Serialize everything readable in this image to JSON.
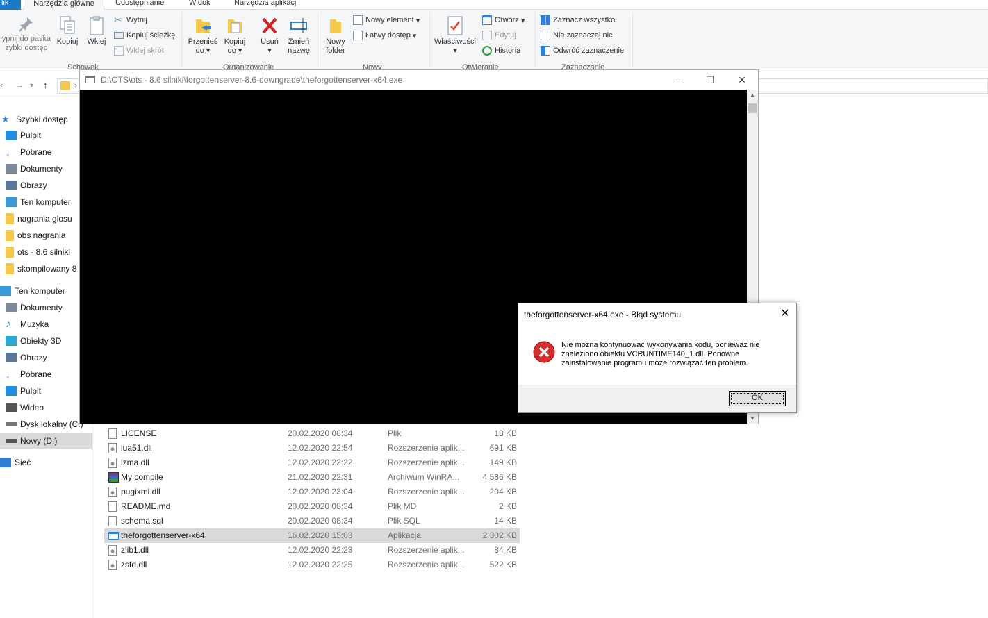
{
  "ribbon": {
    "tabs": [
      "lik",
      "Narzędzia główne",
      "Udostępnianie",
      "Widok",
      "Narzędzia aplikacji"
    ],
    "pin_label_1": "ypnij do paska",
    "pin_label_2": "zybki dostęp",
    "copy": "Kopiuj",
    "paste": "Wklej",
    "cut": "Wytnij",
    "copy_path": "Kopiuj ścieżkę",
    "paste_shortcut": "Wklej skrót",
    "group_clipboard": "Schowek",
    "move_to_1": "Przenieś",
    "move_to_2": "do",
    "copy_to_1": "Kopiuj",
    "copy_to_2": "do",
    "delete": "Usuń",
    "rename_1": "Zmień",
    "rename_2": "nazwę",
    "group_organize": "Organizowanie",
    "new_folder_1": "Nowy",
    "new_folder_2": "folder",
    "new_item": "Nowy element",
    "easy_access": "Łatwy dostęp",
    "group_new": "Nowy",
    "properties": "Właściwości",
    "open": "Otwórz",
    "edit": "Edytuj",
    "history": "Historia",
    "group_open": "Otwieranie",
    "select_all": "Zaznacz wszystko",
    "select_none": "Nie zaznaczaj nic",
    "invert_selection": "Odwróć zaznaczenie",
    "group_select": "Zaznaczanie"
  },
  "nav": {
    "items": [
      {
        "label": "Szybki dostęp",
        "icon": "star-icon",
        "color": "#2f7fd8"
      },
      {
        "label": "Pulpit",
        "icon": "desktop-icon",
        "color": "#1e90e0"
      },
      {
        "label": "Pobrane",
        "icon": "download-icon",
        "color": "#2f7fd8"
      },
      {
        "label": "Dokumenty",
        "icon": "documents-icon",
        "color": "#7a8a9a"
      },
      {
        "label": "Obrazy",
        "icon": "pictures-icon",
        "color": "#5a7896"
      },
      {
        "label": "Ten komputer",
        "icon": "computer-icon",
        "color": "#3a9ad9"
      },
      {
        "label": "nagrania glosu",
        "icon": "folder-icon",
        "color": "#f3c84b"
      },
      {
        "label": "obs nagrania",
        "icon": "folder-icon",
        "color": "#f3c84b"
      },
      {
        "label": "ots - 8.6 silniki",
        "icon": "folder-icon",
        "color": "#f3c84b"
      },
      {
        "label": "skompilowany 8",
        "icon": "folder-icon",
        "color": "#f3c84b"
      },
      {
        "label": "Ten komputer",
        "icon": "computer-icon",
        "color": "#3a9ad9"
      },
      {
        "label": "Dokumenty",
        "icon": "documents-icon",
        "color": "#7a8a9a"
      },
      {
        "label": "Muzyka",
        "icon": "music-icon",
        "color": "#2f7fd8"
      },
      {
        "label": "Obiekty 3D",
        "icon": "cube-icon",
        "color": "#2aa8d8"
      },
      {
        "label": "Obrazy",
        "icon": "pictures-icon",
        "color": "#5a7896"
      },
      {
        "label": "Pobrane",
        "icon": "download-icon",
        "color": "#2f7fd8"
      },
      {
        "label": "Pulpit",
        "icon": "desktop-icon",
        "color": "#1e90e0"
      },
      {
        "label": "Wideo",
        "icon": "video-icon",
        "color": "#555555"
      },
      {
        "label": "Dysk lokalny (C:)",
        "icon": "drive-icon",
        "color": "#777777"
      },
      {
        "label": "Nowy (D:)",
        "icon": "drive-icon",
        "color": "#555555"
      },
      {
        "label": "Sieć",
        "icon": "network-icon",
        "color": "#2f7fd8"
      }
    ]
  },
  "files": [
    {
      "name": "LICENSE",
      "date": "20.02.2020 08:34",
      "type": "Plik",
      "size": "18 KB",
      "icon": "file-icon"
    },
    {
      "name": "lua51.dll",
      "date": "12.02.2020 22:54",
      "type": "Rozszerzenie aplik...",
      "size": "691 KB",
      "icon": "dll-icon"
    },
    {
      "name": "lzma.dll",
      "date": "12.02.2020 22:22",
      "type": "Rozszerzenie aplik...",
      "size": "149 KB",
      "icon": "dll-icon"
    },
    {
      "name": "My compile",
      "date": "21.02.2020 22:31",
      "type": "Archiwum WinRA...",
      "size": "4 586 KB",
      "icon": "winrar-icon"
    },
    {
      "name": "pugixml.dll",
      "date": "12.02.2020 23:04",
      "type": "Rozszerzenie aplik...",
      "size": "204 KB",
      "icon": "dll-icon"
    },
    {
      "name": "README.md",
      "date": "20.02.2020 08:34",
      "type": "Plik MD",
      "size": "2 KB",
      "icon": "file-icon"
    },
    {
      "name": "schema.sql",
      "date": "20.02.2020 08:34",
      "type": "Plik SQL",
      "size": "14 KB",
      "icon": "file-icon"
    },
    {
      "name": "theforgottenserver-x64",
      "date": "16.02.2020 15:03",
      "type": "Aplikacja",
      "size": "2 302 KB",
      "icon": "exe-icon"
    },
    {
      "name": "zlib1.dll",
      "date": "12.02.2020 22:23",
      "type": "Rozszerzenie aplik...",
      "size": "84 KB",
      "icon": "dll-icon"
    },
    {
      "name": "zstd.dll",
      "date": "12.02.2020 22:25",
      "type": "Rozszerzenie aplik...",
      "size": "522 KB",
      "icon": "dll-icon"
    }
  ],
  "console": {
    "title": "D:\\OTS\\ots - 8.6 silniki\\forgottenserver-8.6-downgrade\\theforgottenserver-x64.exe",
    "minimize": "—",
    "maximize": "☐",
    "close": "✕"
  },
  "dialog": {
    "title": "theforgottenserver-x64.exe - Błąd systemu",
    "message": "Nie można kontynuować wykonywania kodu, ponieważ nie znaleziono obiektu VCRUNTIME140_1.dll. Ponowne zainstalowanie programu może rozwiązać ten problem.",
    "ok": "OK",
    "close": "✕"
  },
  "colors": {
    "accent": "#1979ca",
    "error_red": "#d32f2f",
    "selection": "#d9d9d9"
  }
}
